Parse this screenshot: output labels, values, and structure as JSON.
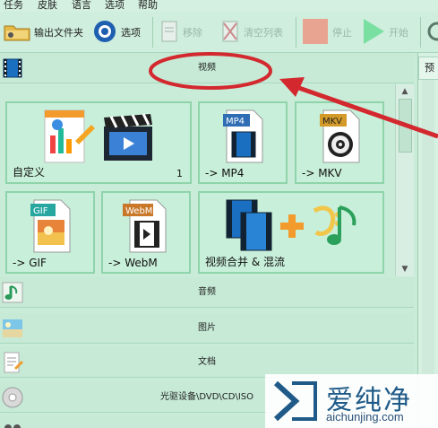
{
  "menu": [
    "任务",
    "皮肤",
    "语言",
    "选项",
    "帮助"
  ],
  "toolbar": {
    "output_folder": "输出文件夹",
    "options": "选项",
    "remove": "移除",
    "clear_list": "清空列表",
    "stop": "停止",
    "start": "开始"
  },
  "right_tab": "预",
  "categories": {
    "video": "视频",
    "audio": "音频",
    "image": "图片",
    "document": "文档",
    "optical": "光驱设备\\DVD\\CD\\ISO"
  },
  "tiles": [
    {
      "label": "自定义",
      "count": "1"
    },
    {
      "label": "-> MP4",
      "badge": "MP4"
    },
    {
      "label": "-> MKV",
      "badge": "MKV"
    },
    {
      "label": "-> GIF",
      "badge": "GIF"
    },
    {
      "label": "-> WebM",
      "badge": "WebM"
    },
    {
      "label": "视频合并 & 混流"
    }
  ],
  "watermark": {
    "name": "爱纯净",
    "url": "aichunjing.com"
  },
  "colors": {
    "annotation": "#d3282e",
    "panel_bg": "#c9ecd8",
    "tile_border": "#8fd4ab"
  }
}
